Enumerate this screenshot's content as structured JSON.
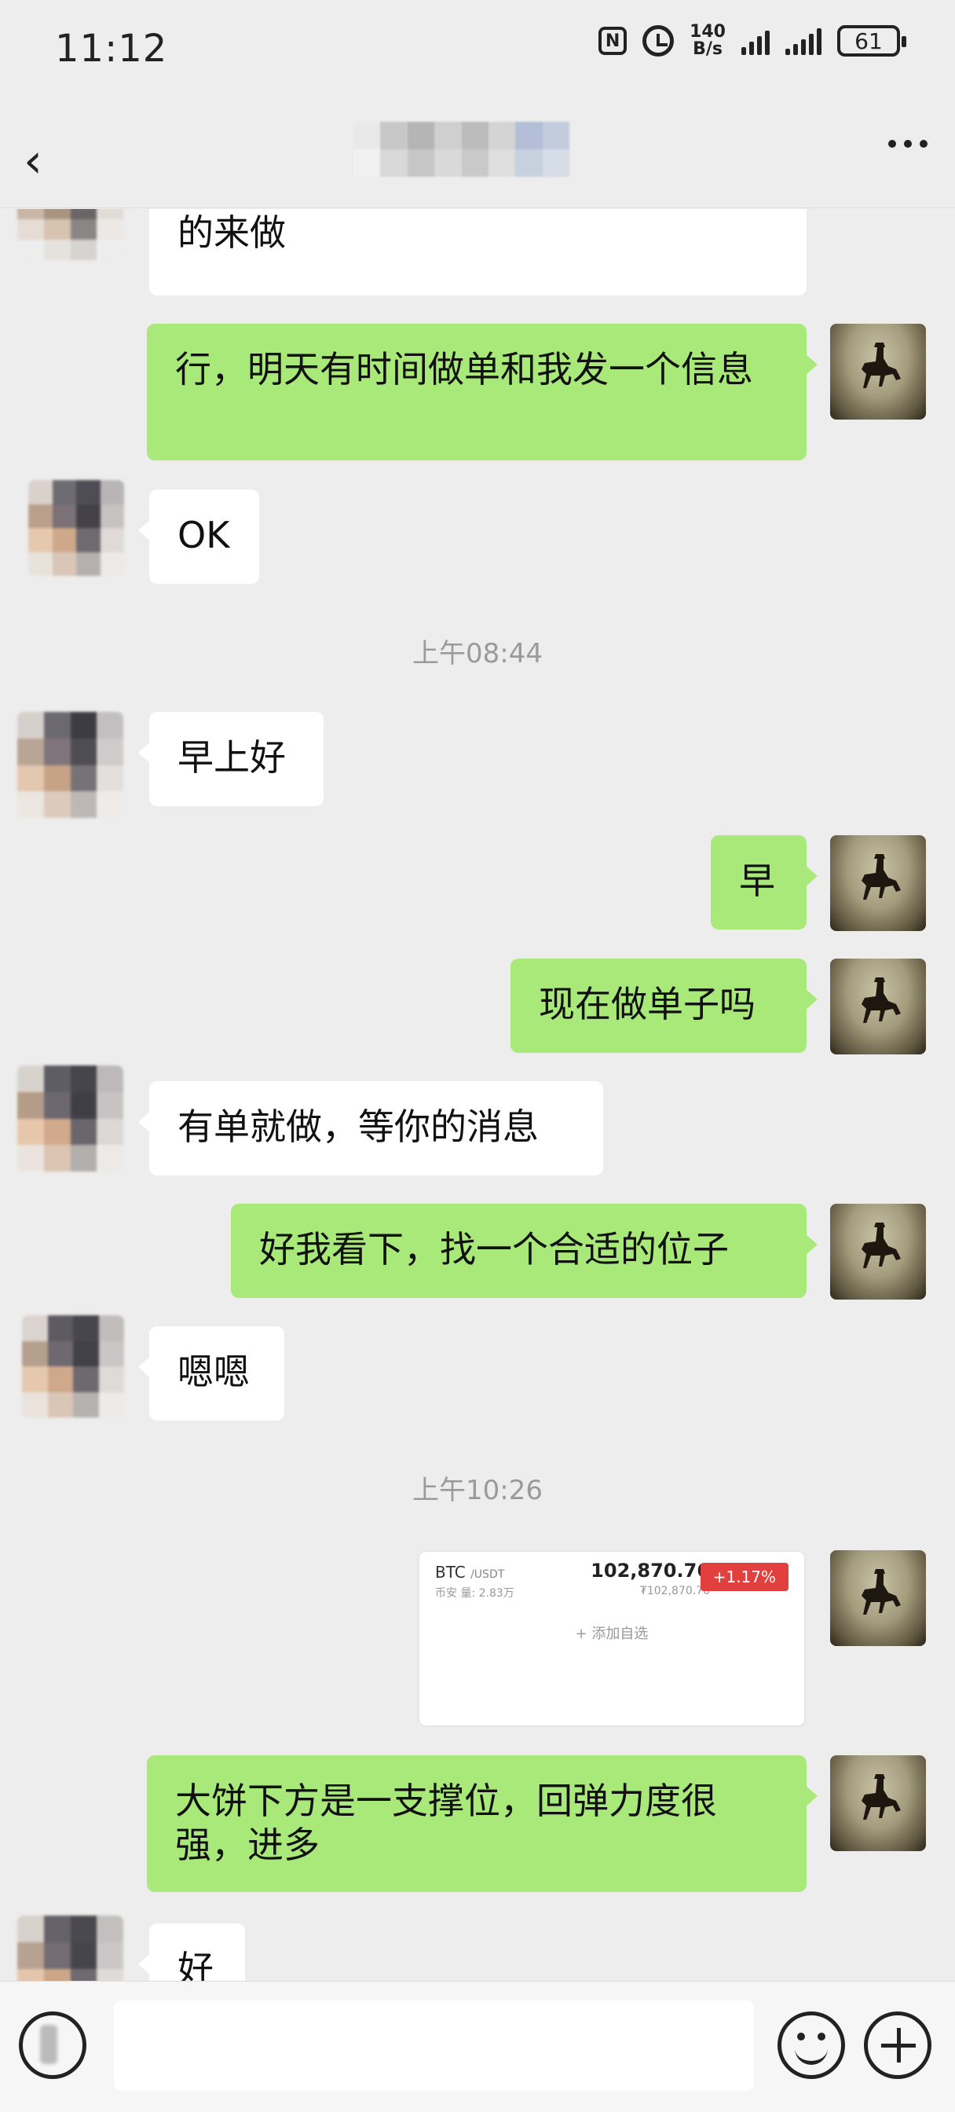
{
  "status_bar": {
    "time": "11:12",
    "nfc_label": "N",
    "net_speed_value": "140",
    "net_speed_unit": "B/s",
    "battery": "61"
  },
  "messages": {
    "m1": "明天吧，晚上调整一下心情，大好好的来做",
    "m2": "行，明天有时间做单和我发一个信息",
    "m3": "OK",
    "ts1": "上午08:44",
    "m4": "早上好",
    "m5": "早",
    "m6": "现在做单子吗",
    "m7": "有单就做，等你的消息",
    "m8": "好我看下，找一个合适的位子",
    "m9": "嗯嗯",
    "ts2": "上午10:26",
    "m10": "大饼下方是一支撑位，回弹力度很强，进多",
    "m11": "好"
  },
  "card": {
    "pair": "BTC",
    "quote": "/USDT",
    "exchange_volume": "币安  量: 2.83万",
    "price": "102,870.76",
    "fiat": "₮102,870.76",
    "change": "+1.17%",
    "add_label": "+ 添加自选"
  },
  "colors": {
    "background": "#ededed",
    "bubble_self": "#a9e97a",
    "bubble_other": "#ffffff",
    "change_badge": "#e2403f"
  }
}
